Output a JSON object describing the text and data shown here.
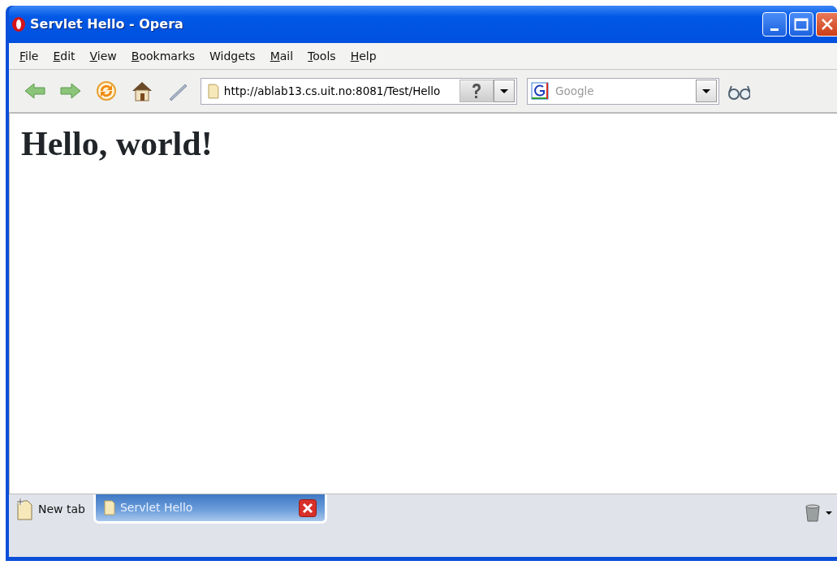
{
  "window": {
    "title": "Servlet Hello - Opera"
  },
  "menu": [
    {
      "label": "File",
      "access_key_underlined": true
    },
    {
      "label": "Edit",
      "access_key_underlined": true
    },
    {
      "label": "View",
      "access_key_underlined": true
    },
    {
      "label": "Bookmarks",
      "access_key_underlined": true
    },
    {
      "label": "Widgets",
      "access_key_underlined": false
    },
    {
      "label": "Mail",
      "access_key_underlined": true
    },
    {
      "label": "Tools",
      "access_key_underlined": true
    },
    {
      "label": "Help",
      "access_key_underlined": true
    }
  ],
  "address": {
    "value": "http://ablab13.cs.uit.no:8081/Test/Hello"
  },
  "search": {
    "placeholder": "Google"
  },
  "page": {
    "heading": "Hello, world!"
  },
  "tabs": [
    {
      "label": "New tab",
      "kind": "new",
      "selected": false
    },
    {
      "label": "Servlet Hello",
      "kind": "page",
      "selected": true
    }
  ]
}
